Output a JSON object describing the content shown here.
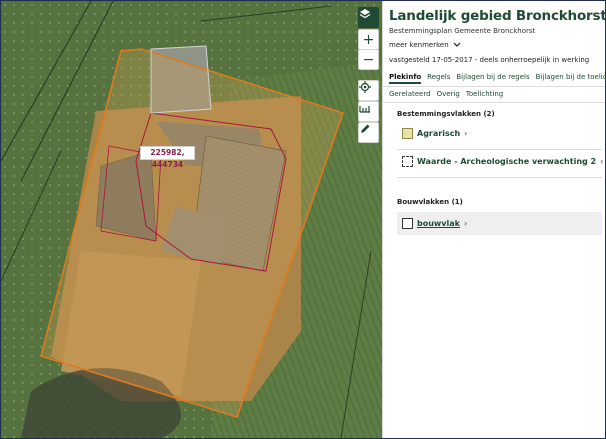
{
  "panel": {
    "title": "Landelijk gebied Bronckhorst",
    "subtitle": "Bestemmingsplan  Gemeente Bronckhorst",
    "more_label": "meer kenmerken",
    "status": "vastgesteld 17-05-2017 - deels onherroepelijk in werking",
    "tabs_row1": [
      "Plekinfo",
      "Regels",
      "Bijlagen bij de regels",
      "Bijlagen bij de toelichting"
    ],
    "tabs_row2": [
      "Gerelateerd",
      "Overig",
      "Toelichting"
    ],
    "sections": [
      {
        "heading": "Bestemmingsvlakken (2)",
        "items": [
          "Agrarisch",
          "Waarde - Archeologische verwachting 2"
        ]
      },
      {
        "heading": "Bouwvlakken (1)",
        "items": [
          "bouwvlak"
        ]
      }
    ]
  },
  "map": {
    "coordinate_label": "225982, 444734",
    "buttons": [
      "layers-icon",
      "zoom-in-icon",
      "zoom-out-icon",
      "locate-icon",
      "measure-icon",
      "draw-icon"
    ]
  },
  "colors": {
    "accent": "#1f4a35",
    "plan_outline": "#e07a1d",
    "bouwvlak_outline": "#a8173d",
    "agrarisch_fill": "#e7e3a6"
  }
}
